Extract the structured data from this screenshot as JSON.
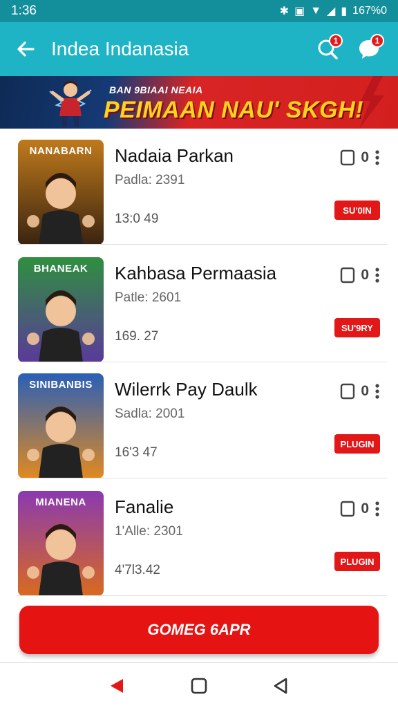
{
  "status_bar": {
    "time": "1:36",
    "battery": "167%0"
  },
  "app_bar": {
    "title": "Indea Indanasia",
    "search_badge": "1",
    "chat_badge": "1"
  },
  "banner": {
    "small_text": "BAN 9BIAAI NEAIA",
    "big_text": "PEIMAAN NAU' SKGH!"
  },
  "games": [
    {
      "name": "Nadaia Parkan",
      "meta": "Padla: 2391",
      "size": "13:0 49",
      "count": "0",
      "status": "SU'0IN",
      "thumb_title": "NANABARN",
      "thumb_colors": [
        "#c07a1c",
        "#3a2410"
      ]
    },
    {
      "name": "Kahbasa Permaasia",
      "meta": "Patle: 2601",
      "size": "169. 27",
      "count": "0",
      "status": "SU'9RY",
      "thumb_title": "BHANEAK",
      "thumb_colors": [
        "#2f8f3f",
        "#5a3a9a"
      ]
    },
    {
      "name": "Wilerrk Pay Daulk",
      "meta": "Sadla: 2001",
      "size": "16'3 47",
      "count": "0",
      "status": "PLUGIN",
      "thumb_title": "SINIBANBIS",
      "thumb_colors": [
        "#2a5fb8",
        "#e08a20"
      ]
    },
    {
      "name": "Fanalie",
      "meta": "1'Alle: 2301",
      "size": "4'7l3.42",
      "count": "0",
      "status": "PLUGIN",
      "thumb_title": "MIANENA",
      "thumb_colors": [
        "#8a3ab0",
        "#d86a20"
      ]
    }
  ],
  "cta": {
    "label": "GOMEG 6APR"
  },
  "colors": {
    "primary": "#1fb3c6",
    "status": "#138f9c",
    "accent": "#e21717"
  }
}
